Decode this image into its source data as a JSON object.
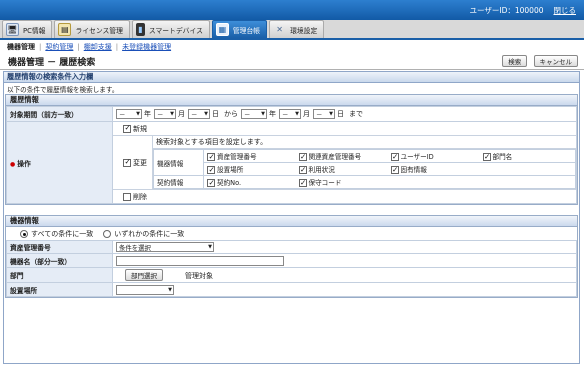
{
  "header": {
    "user_id": "ユーザーID：100000",
    "close": "閉じる"
  },
  "tabs": [
    {
      "label": "PC情報",
      "icon": "pc-icon"
    },
    {
      "label": "ライセンス管理",
      "icon": "license-icon"
    },
    {
      "label": "スマートデバイス",
      "icon": "smartphone-icon"
    },
    {
      "label": "管理台帳",
      "icon": "ledger-icon"
    },
    {
      "label": "環境設定",
      "icon": "settings-icon"
    }
  ],
  "subnav": {
    "current": "機器管理",
    "links": [
      "契約管理",
      "棚卸支援",
      "未登録機器管理"
    ]
  },
  "title": "機器管理 － 履歴検索",
  "buttons": {
    "search": "検索",
    "cancel": "キャンセル"
  },
  "panel_title": "履歴情報の検索条件入力欄",
  "intro": "以下の条件で履歴情報を検索します。",
  "history": {
    "heading": "履歴情報",
    "period": {
      "label": "対象期間（前方一致）",
      "select_value": "－",
      "units": [
        "年",
        "月",
        "日",
        "から",
        "年",
        "月",
        "日",
        "まで"
      ]
    },
    "operation": {
      "label": "操作",
      "new": "新規",
      "change": "変更",
      "delete": "削除",
      "item_instruction": "検索対象とする項目を設定します。",
      "groups": [
        {
          "name": "機器情報",
          "rows": [
            [
              "資産管理番号",
              "関連資産管理番号",
              "ユーザーID",
              "部門名"
            ],
            [
              "設置場所",
              "利用状況",
              "固有情報"
            ]
          ]
        },
        {
          "name": "契約情報",
          "rows": [
            [
              "契約No.",
              "保守コード"
            ]
          ]
        }
      ]
    }
  },
  "device": {
    "heading": "機器情報",
    "radio_all": "すべての条件に一致",
    "radio_any": "いずれかの条件に一致",
    "asset_label": "資産管理番号",
    "asset_select": "条件を選択",
    "name_label": "機器名（部分一致）",
    "dept_label": "部門",
    "dept_button": "部門選択",
    "dept_note": "管理対象",
    "location_label": "設置場所"
  }
}
